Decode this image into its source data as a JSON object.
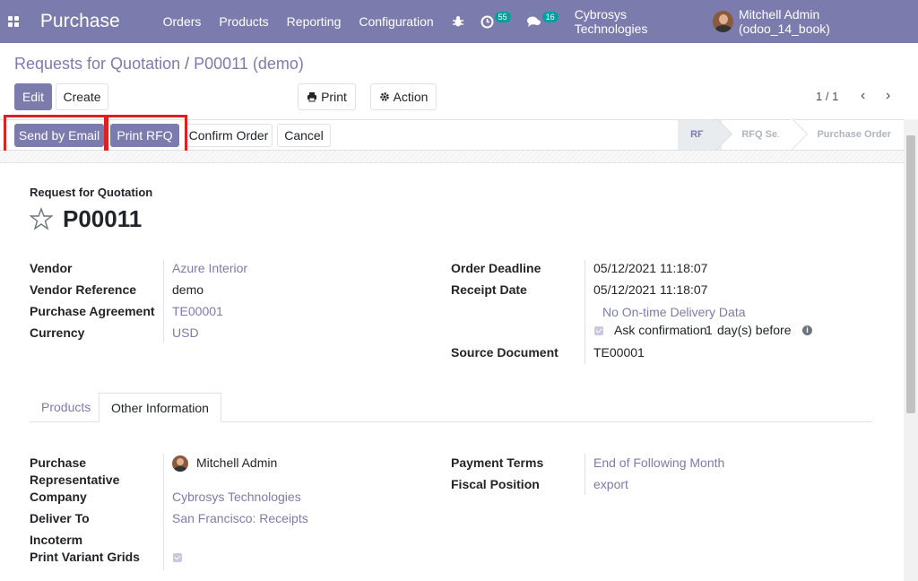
{
  "navbar": {
    "app_name": "Purchase",
    "menu": [
      "Orders",
      "Products",
      "Reporting",
      "Configuration"
    ],
    "activity_count": "55",
    "message_count": "16",
    "company": "Cybrosys Technologies",
    "user": "Mitchell Admin (odoo_14_book)"
  },
  "breadcrumb": {
    "parent": "Requests for Quotation",
    "separator": "/",
    "current": "P00011 (demo)"
  },
  "control": {
    "edit": "Edit",
    "create": "Create",
    "print": "Print",
    "action": "Action",
    "pager": "1 / 1"
  },
  "statusbar": {
    "buttons": [
      "Send by Email",
      "Print RFQ",
      "Confirm Order",
      "Cancel"
    ],
    "stages": [
      "RFQ",
      "RFQ Sent",
      "Purchase Order"
    ],
    "active_stage": "RFQ"
  },
  "record": {
    "type_label": "Request for Quotation",
    "name": "P00011"
  },
  "fields_left": [
    {
      "label": "Vendor",
      "value": "Azure Interior",
      "link": true
    },
    {
      "label": "Vendor Reference",
      "value": "demo",
      "link": false
    },
    {
      "label": "Purchase Agreement",
      "value": "TE00001",
      "link": true
    },
    {
      "label": "Currency",
      "value": "USD",
      "link": true
    }
  ],
  "fields_right": {
    "order_deadline_label": "Order Deadline",
    "order_deadline": "05/12/2021 11:18:07",
    "receipt_date_label": "Receipt Date",
    "receipt_date": "05/12/2021 11:18:07",
    "on_time_link": "No On-time Delivery Data",
    "ask_confirmation": "Ask confirmation",
    "ask_days": "1",
    "ask_suffix": "day(s) before",
    "source_doc_label": "Source Document",
    "source_doc": "TE00001"
  },
  "tabs": [
    "Products",
    "Other Information"
  ],
  "active_tab": "Other Information",
  "other_info_left": {
    "rep_label_1": "Purchase",
    "rep_label_2": "Representative",
    "rep_value": "Mitchell Admin",
    "company_label": "Company",
    "company_value": "Cybrosys Technologies",
    "deliver_label": "Deliver To",
    "deliver_value": "San Francisco: Receipts",
    "incoterm_label": "Incoterm",
    "variant_label": "Print Variant Grids"
  },
  "other_info_right": {
    "payment_label": "Payment Terms",
    "payment_value": "End of Following Month",
    "fiscal_label": "Fiscal Position",
    "fiscal_value": "export"
  },
  "colors": {
    "brand": "#7c7bad",
    "highlight": "#e02020",
    "badge": "#00a09d"
  }
}
